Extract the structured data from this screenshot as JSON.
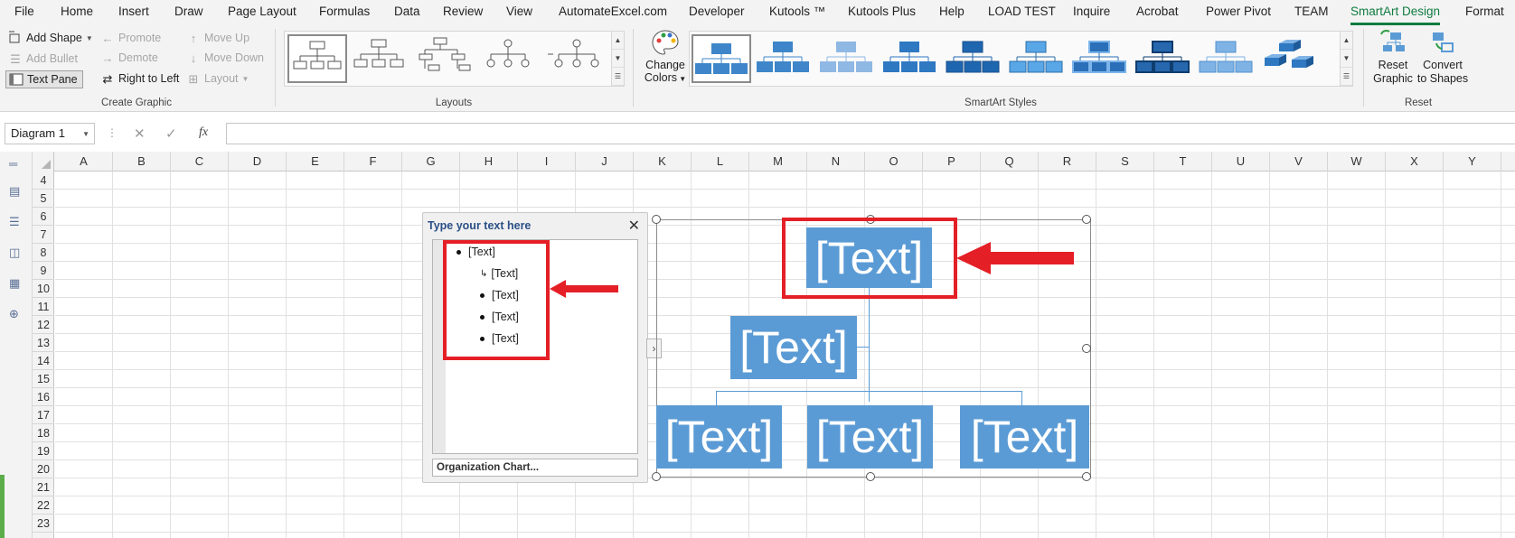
{
  "menu": {
    "items": [
      "File",
      "Home",
      "Insert",
      "Draw",
      "Page Layout",
      "Formulas",
      "Data",
      "Review",
      "View",
      "AutomateExcel.com",
      "Developer",
      "Kutools ™",
      "Kutools Plus",
      "Help",
      "LOAD TEST",
      "Inquire",
      "Acrobat",
      "Power Pivot",
      "TEAM",
      "SmartArt Design",
      "Format"
    ],
    "active": "SmartArt Design"
  },
  "ribbon": {
    "create_graphic": {
      "add_shape": "Add Shape",
      "add_bullet": "Add Bullet",
      "text_pane": "Text Pane",
      "promote": "Promote",
      "demote": "Demote",
      "right_to_left": "Right to Left",
      "move_up": "Move Up",
      "move_down": "Move Down",
      "layout": "Layout",
      "label": "Create Graphic"
    },
    "layouts": {
      "label": "Layouts"
    },
    "change_colors": {
      "line1": "Change",
      "line2": "Colors"
    },
    "styles": {
      "label": "SmartArt Styles"
    },
    "reset": {
      "reset_l1": "Reset",
      "reset_l2": "Graphic",
      "convert_l1": "Convert",
      "convert_l2": "to Shapes",
      "label": "Reset"
    }
  },
  "formula": {
    "namebox": "Diagram 1",
    "fx": "fx"
  },
  "columns": [
    "A",
    "B",
    "C",
    "D",
    "E",
    "F",
    "G",
    "H",
    "I",
    "J",
    "K",
    "L",
    "M",
    "N",
    "O",
    "P",
    "Q",
    "R",
    "S",
    "T",
    "U",
    "V",
    "W",
    "X",
    "Y"
  ],
  "rows": [
    "4",
    "5",
    "6",
    "7",
    "8",
    "9",
    "10",
    "11",
    "12",
    "13",
    "14",
    "15",
    "16",
    "17",
    "18",
    "19",
    "20",
    "21",
    "22",
    "23"
  ],
  "text_pane": {
    "title": "Type your text here",
    "items": [
      "[Text]",
      "[Text]",
      "[Text]",
      "[Text]",
      "[Text]"
    ],
    "footer": "Organization Chart..."
  },
  "smartart": {
    "top": "[Text]",
    "assistant": "[Text]",
    "bottom": [
      "[Text]",
      "[Text]",
      "[Text]"
    ],
    "color": "#5b9bd5"
  },
  "annotation_color": "#e41f26"
}
